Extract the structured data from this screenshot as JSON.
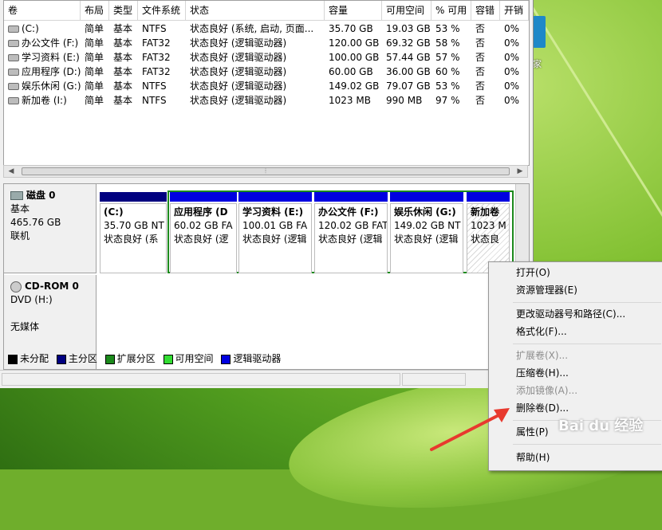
{
  "desktop": {
    "icon_label": "家"
  },
  "columns": [
    "卷",
    "布局",
    "类型",
    "文件系统",
    "状态",
    "容量",
    "可用空间",
    "% 可用",
    "容错",
    "开销"
  ],
  "volumes": [
    [
      "(C:)",
      "简单",
      "基本",
      "NTFS",
      "状态良好 (系统, 启动, 页面...",
      "35.70 GB",
      "19.03 GB",
      "53 %",
      "否",
      "0%"
    ],
    [
      "办公文件 (F:)",
      "简单",
      "基本",
      "FAT32",
      "状态良好 (逻辑驱动器)",
      "120.00 GB",
      "69.32 GB",
      "58 %",
      "否",
      "0%"
    ],
    [
      "学习资料 (E:)",
      "简单",
      "基本",
      "FAT32",
      "状态良好 (逻辑驱动器)",
      "100.00 GB",
      "57.44 GB",
      "57 %",
      "否",
      "0%"
    ],
    [
      "应用程序 (D:)",
      "简单",
      "基本",
      "FAT32",
      "状态良好 (逻辑驱动器)",
      "60.00 GB",
      "36.00 GB",
      "60 %",
      "否",
      "0%"
    ],
    [
      "娱乐休闲 (G:)",
      "简单",
      "基本",
      "NTFS",
      "状态良好 (逻辑驱动器)",
      "149.02 GB",
      "79.07 GB",
      "53 %",
      "否",
      "0%"
    ],
    [
      "新加卷 (I:)",
      "简单",
      "基本",
      "NTFS",
      "状态良好 (逻辑驱动器)",
      "1023 MB",
      "990 MB",
      "97 %",
      "否",
      "0%"
    ]
  ],
  "disk0": {
    "name": "磁盘 0",
    "type": "基本",
    "size": "465.76 GB",
    "status": "联机"
  },
  "cdrom0": {
    "name": "CD-ROM 0",
    "drive": "DVD (H:)",
    "media": "无媒体"
  },
  "partitions": [
    {
      "name": "(C:)",
      "size": "35.70 GB NT",
      "status": "状态良好 (系"
    },
    {
      "name": "应用程序 (D",
      "size": "60.02 GB FA",
      "status": "状态良好 (逻"
    },
    {
      "name": "学习资料 (E:)",
      "size": "100.01 GB FA",
      "status": "状态良好 (逻辑"
    },
    {
      "name": "办公文件 (F:)",
      "size": "120.02 GB FAT",
      "status": "状态良好 (逻辑"
    },
    {
      "name": "娱乐休闲 (G:)",
      "size": "149.02 GB NT",
      "status": "状态良好 (逻辑"
    },
    {
      "name": "新加卷",
      "size": "1023 M",
      "status": "状态良"
    }
  ],
  "legend": [
    {
      "label": "未分配",
      "color": "#000000"
    },
    {
      "label": "主分区",
      "color": "#000080"
    },
    {
      "label": "扩展分区",
      "color": "#1c8a1c"
    },
    {
      "label": "可用空间",
      "color": "#33dd33"
    },
    {
      "label": "逻辑驱动器",
      "color": "#0000e0"
    }
  ],
  "context_menu": [
    {
      "label": "打开(O)",
      "enabled": true
    },
    {
      "label": "资源管理器(E)",
      "enabled": true
    },
    {
      "label": "更改驱动器号和路径(C)...",
      "enabled": true
    },
    {
      "label": "格式化(F)...",
      "enabled": true
    },
    {
      "label": "扩展卷(X)...",
      "enabled": false
    },
    {
      "label": "压缩卷(H)...",
      "enabled": true
    },
    {
      "label": "添加镜像(A)...",
      "enabled": false
    },
    {
      "label": "删除卷(D)...",
      "enabled": true
    },
    {
      "label": "属性(P)",
      "enabled": true
    },
    {
      "label": "帮助(H)",
      "enabled": true
    }
  ],
  "watermark": "Bai du 经验",
  "colors": {
    "primary_partition": "#000080",
    "logical_drive": "#0000e0",
    "extended_partition": "#1c8a1c",
    "annotation_arrow": "#e8392e"
  }
}
